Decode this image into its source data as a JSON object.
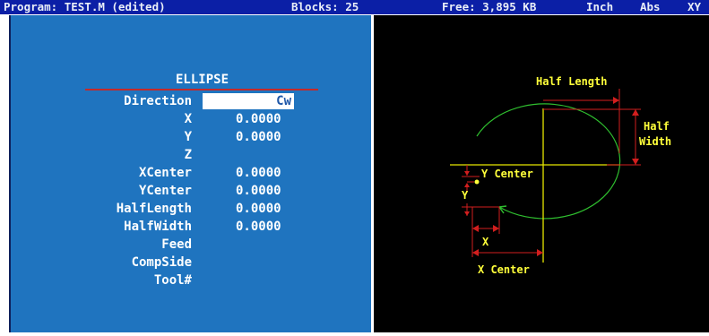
{
  "status_bar": {
    "program": "Program: TEST.M (edited)",
    "blocks": "Blocks: 25",
    "free": "Free: 3,895 KB",
    "units": "Inch",
    "mode": "Abs",
    "plane": "XY"
  },
  "form": {
    "title": "ELLIPSE",
    "fields": [
      {
        "label": "Direction",
        "value": "Cw"
      },
      {
        "label": "X",
        "value": "0.0000"
      },
      {
        "label": "Y",
        "value": "0.0000"
      },
      {
        "label": "Z",
        "value": ""
      },
      {
        "label": "XCenter",
        "value": "0.0000"
      },
      {
        "label": "YCenter",
        "value": "0.0000"
      },
      {
        "label": "HalfLength",
        "value": "0.0000"
      },
      {
        "label": "HalfWidth",
        "value": "0.0000"
      },
      {
        "label": "Feed",
        "value": ""
      },
      {
        "label": "CompSide",
        "value": ""
      },
      {
        "label": "Tool#",
        "value": ""
      }
    ]
  },
  "diagram": {
    "half_length": "Half Length",
    "half": "Half",
    "width": "Width",
    "y_center": "Y Center",
    "y": "Y",
    "x": "X",
    "x_center": "X Center",
    "colors": {
      "ellipse": "#2fbf2f",
      "axes": "#e6e600",
      "dims": "#d21e1e",
      "text": "#ffff3a"
    }
  }
}
